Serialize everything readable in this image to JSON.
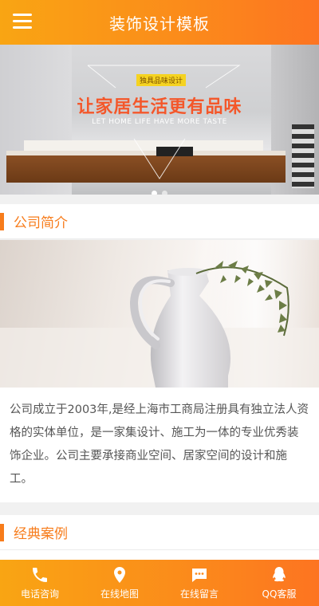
{
  "header": {
    "title": "装饰设计模板",
    "menu_icon": "menu-icon"
  },
  "banner": {
    "badge": "独具品味设计",
    "slogan": "让家居生活更有品味",
    "subtitle": "LET HOME LIFE HAVE MORE TASTE",
    "slides_total": 2,
    "slides_active": 1
  },
  "about": {
    "heading": "公司简介",
    "text": "公司成立于2003年,是经上海市工商局注册具有独立法人资格的实体单位，是一家集设计、施工为一体的专业优秀装饰企业。公司主要承接商业空间、居家空间的设计和施工。"
  },
  "cases": {
    "heading": "经典案例"
  },
  "footer": {
    "items": [
      {
        "label": "电话咨询",
        "icon": "phone-icon"
      },
      {
        "label": "在线地图",
        "icon": "map-pin-icon"
      },
      {
        "label": "在线留言",
        "icon": "message-icon"
      },
      {
        "label": "QQ客服",
        "icon": "qq-icon"
      }
    ]
  },
  "colors": {
    "accent": "#f77c1b",
    "header_start": "#f9a513",
    "header_end": "#fd7421"
  }
}
